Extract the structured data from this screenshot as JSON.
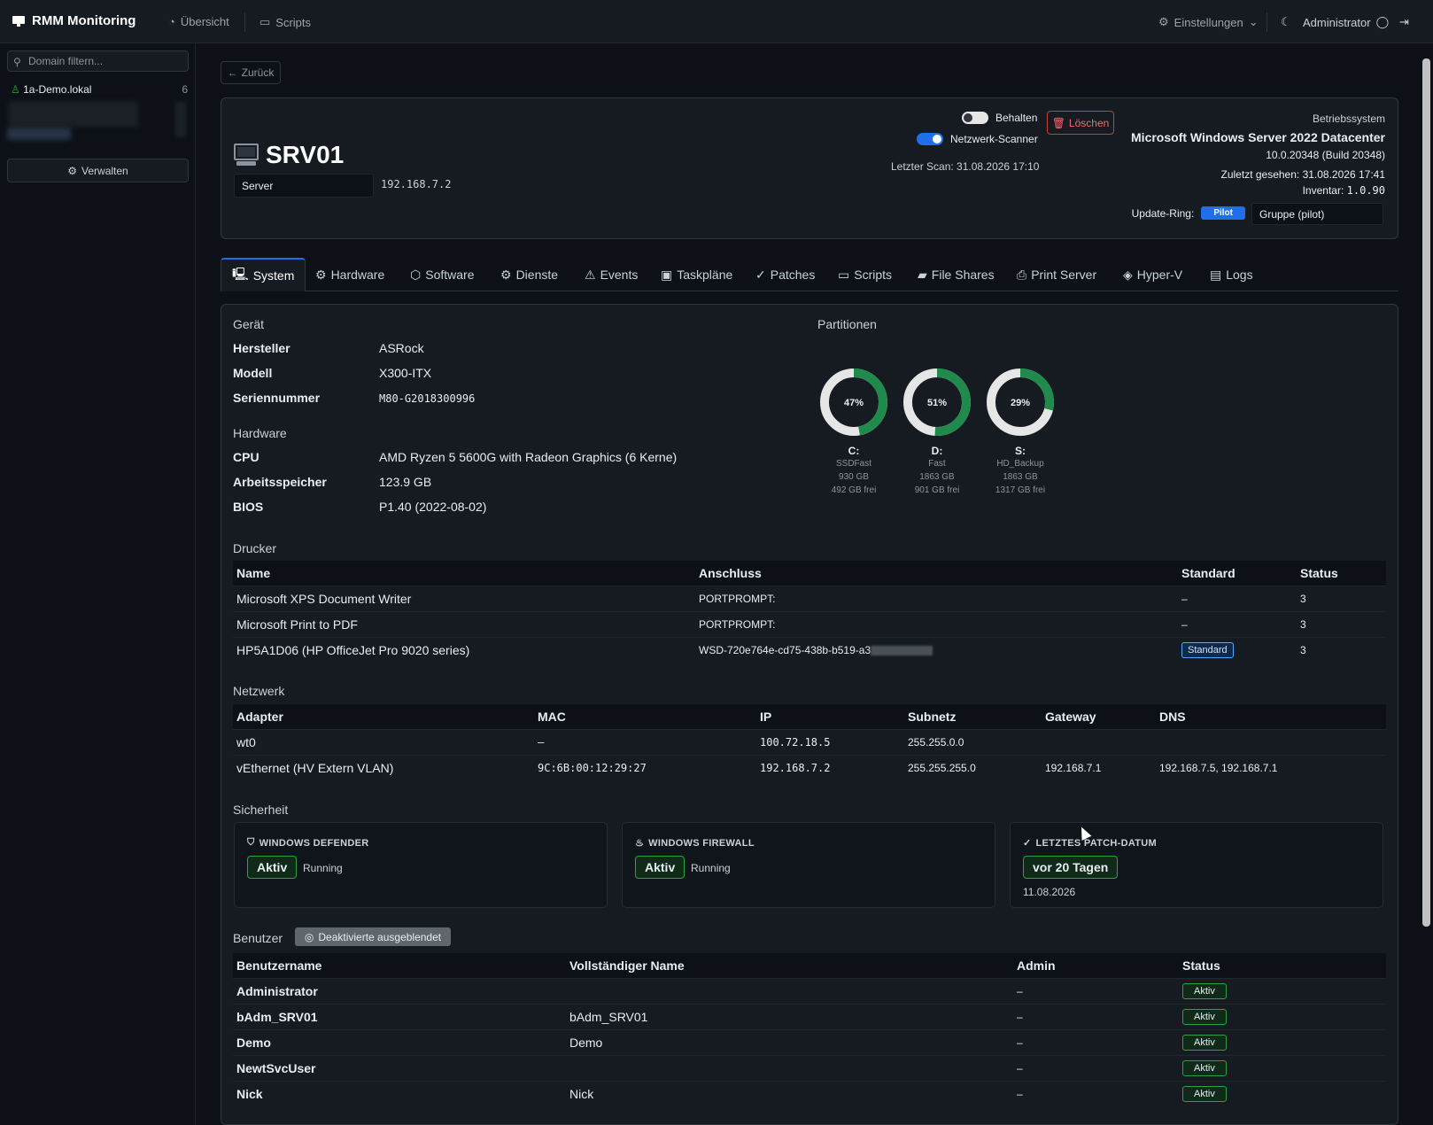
{
  "nav": {
    "brand": "RMM Monitoring",
    "overview": "Übersicht",
    "scripts": "Scripts",
    "settings": "Einstellungen",
    "user": "Administrator"
  },
  "sidebar": {
    "search_placeholder": "Domain filtern...",
    "domain_name": "1a-Demo.lokal",
    "domain_count": "6",
    "manage_label": "Verwalten"
  },
  "back_label": "Zurück",
  "host": {
    "name": "SRV01",
    "role": "Server",
    "ip": "192.168.7.2",
    "keep_label": "Behalten",
    "keep_on": false,
    "scanner_label": "Netzwerk-Scanner",
    "scanner_on": true,
    "last_scan": "Letzter Scan: 31.08.2026 17:10",
    "delete_label": "Löschen",
    "os_caption": "Betriebssystem",
    "os_name": "Microsoft Windows Server 2022 Datacenter",
    "os_build": "10.0.20348 (Build 20348)",
    "last_seen": "Zuletzt gesehen: 31.08.2026 17:41",
    "inventory_label": "Inventar:",
    "inventory_version": "1.0.90",
    "update_ring_label": "Update-Ring:",
    "update_ring": "Pilot",
    "group": "Gruppe (pilot)"
  },
  "tabs": [
    "System",
    "Hardware",
    "Software",
    "Dienste",
    "Events",
    "Taskpläne",
    "Patches",
    "Scripts",
    "File Shares",
    "Print Server",
    "Hyper-V",
    "Logs"
  ],
  "device": {
    "title": "Gerät",
    "manufacturer_label": "Hersteller",
    "manufacturer": "ASRock",
    "model_label": "Modell",
    "model": "X300-ITX",
    "serial_label": "Seriennummer",
    "serial": "M80-G2018300996"
  },
  "hardware": {
    "title": "Hardware",
    "cpu_label": "CPU",
    "cpu": "AMD Ryzen 5 5600G with Radeon Graphics (6 Kerne)",
    "ram_label": "Arbeitsspeicher",
    "ram": "123.9 GB",
    "bios_label": "BIOS",
    "bios": "P1.40 (2022-08-02)"
  },
  "partitions": {
    "title": "Partitionen",
    "items": [
      {
        "drive": "C:",
        "label": "SSDFast",
        "size": "930 GB",
        "free": "492 GB frei",
        "used_pct": 47,
        "used_text": "47%"
      },
      {
        "drive": "D:",
        "label": "Fast",
        "size": "1863 GB",
        "free": "901 GB frei",
        "used_pct": 51,
        "used_text": "51%"
      },
      {
        "drive": "S:",
        "label": "HD_Backup",
        "size": "1863 GB",
        "free": "1317 GB frei",
        "used_pct": 29,
        "used_text": "29%"
      }
    ]
  },
  "printers": {
    "title": "Drucker",
    "headers": [
      "Name",
      "Anschluss",
      "Standard",
      "Status"
    ],
    "rows": [
      {
        "name": "Microsoft XPS Document Writer",
        "port": "PORTPROMPT:",
        "standard": "–",
        "status": "3"
      },
      {
        "name": "Microsoft Print to PDF",
        "port": "PORTPROMPT:",
        "standard": "–",
        "status": "3"
      },
      {
        "name": "HP5A1D06 (HP OfficeJet Pro 9020 series)",
        "port": "WSD-720e764e-cd75-438b-b519-a3",
        "standard": "Standard",
        "status": "3"
      }
    ]
  },
  "network": {
    "title": "Netzwerk",
    "headers": [
      "Adapter",
      "MAC",
      "IP",
      "Subnetz",
      "Gateway",
      "DNS"
    ],
    "rows": [
      {
        "adapter": "wt0",
        "mac": "–",
        "ip": "100.72.18.5",
        "subnet": "255.255.0.0",
        "gateway": "",
        "dns": ""
      },
      {
        "adapter": "vEthernet (HV Extern VLAN)",
        "mac": "9C:6B:00:12:29:27",
        "ip": "192.168.7.2",
        "subnet": "255.255.255.0",
        "gateway": "192.168.7.1",
        "dns": "192.168.7.5, 192.168.7.1"
      }
    ]
  },
  "security": {
    "title": "Sicherheit",
    "defender_title": "WINDOWS DEFENDER",
    "defender_badge": "Aktiv",
    "defender_status": "Running",
    "firewall_title": "WINDOWS FIREWALL",
    "firewall_badge": "Aktiv",
    "firewall_status": "Running",
    "patch_title": "LETZTES PATCH-DATUM",
    "patch_badge": "vor 20 Tagen",
    "patch_date": "11.08.2026"
  },
  "users": {
    "title": "Benutzer",
    "toggle_label": "Deaktivierte ausgeblendet",
    "headers": [
      "Benutzername",
      "Vollständiger Name",
      "Admin",
      "Status"
    ],
    "rows": [
      {
        "user": "Administrator",
        "full": "",
        "admin": "–",
        "status": "Aktiv"
      },
      {
        "user": "bAdm_SRV01",
        "full": "bAdm_SRV01",
        "admin": "–",
        "status": "Aktiv"
      },
      {
        "user": "Demo",
        "full": "Demo",
        "admin": "–",
        "status": "Aktiv"
      },
      {
        "user": "NewtSvcUser",
        "full": "",
        "admin": "–",
        "status": "Aktiv"
      },
      {
        "user": "Nick",
        "full": "Nick",
        "admin": "–",
        "status": "Aktiv"
      }
    ]
  },
  "colors": {
    "accent": "#1f6feb",
    "success": "#2ea043",
    "danger": "#c73d3d",
    "donut_used": "#1f8a4c",
    "donut_free": "#e6e6e6"
  }
}
